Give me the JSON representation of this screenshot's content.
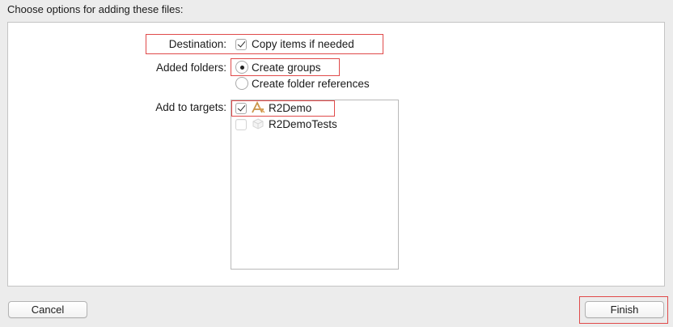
{
  "dialog": {
    "header": "Choose options for adding these files:"
  },
  "destination": {
    "label": "Destination:",
    "option_label": "Copy items if needed",
    "checked": true
  },
  "added_folders": {
    "label": "Added folders:",
    "options": [
      {
        "label": "Create groups",
        "selected": true
      },
      {
        "label": "Create folder references",
        "selected": false
      }
    ]
  },
  "targets": {
    "label": "Add to targets:",
    "items": [
      {
        "name": "R2Demo",
        "checked": true,
        "icon": "app-target-icon"
      },
      {
        "name": "R2DemoTests",
        "checked": false,
        "icon": "test-bundle-icon"
      }
    ]
  },
  "buttons": {
    "cancel": "Cancel",
    "finish": "Finish"
  },
  "colors": {
    "highlight": "#e04a4a",
    "background": "#ececec",
    "panel": "#ffffff"
  }
}
